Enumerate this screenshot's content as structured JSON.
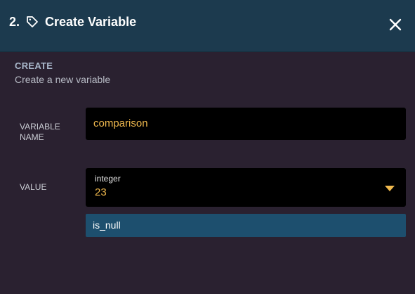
{
  "header": {
    "step": "2.",
    "title": "Create Variable",
    "icon": "tag-icon",
    "close_icon": "close-icon"
  },
  "section": {
    "label": "CREATE",
    "description": "Create a new variable"
  },
  "fields": {
    "name_label_line1": "VARIABLE",
    "name_label_line2": "NAME",
    "name_value": "comparison",
    "value_label": "VALUE",
    "value_type": "integer",
    "value": "23",
    "dropdown_icon": "caret-down-icon"
  },
  "options": [
    "is_null"
  ],
  "colors": {
    "header_bg": "#1c3a4e",
    "body_bg": "#2a2130",
    "accent_text": "#f0b94e",
    "option_bg": "#1d4f6e",
    "caret": "#f0b94e"
  }
}
